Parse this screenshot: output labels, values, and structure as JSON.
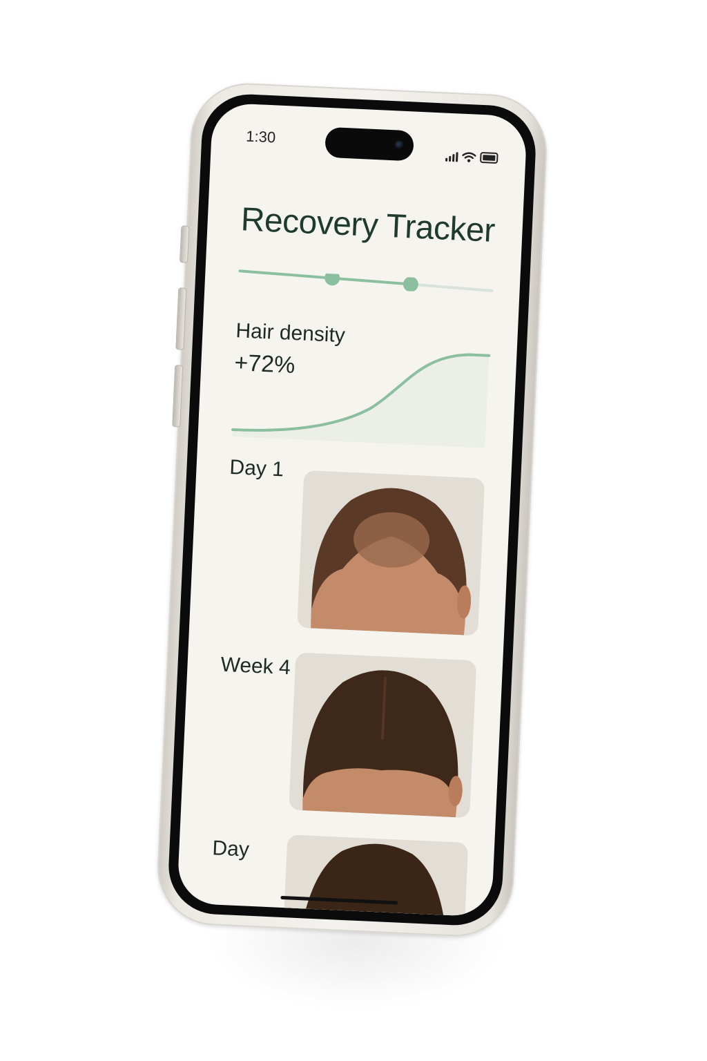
{
  "status_bar": {
    "time": "1:30"
  },
  "screen": {
    "title": "Recovery Tracker",
    "progress_stepper": {
      "steps_completed": 2,
      "accent_color": "#8cbf9f",
      "track_color": "#d9e2dc"
    },
    "metric": {
      "label": "Hair density",
      "value": "+72%"
    },
    "entries": [
      {
        "label": "Day 1",
        "image": "scalp-photo-day-1"
      },
      {
        "label": "Week 4",
        "image": "scalp-photo-week-4"
      },
      {
        "label": "Day",
        "image": "scalp-photo-day"
      }
    ]
  },
  "colors": {
    "screen_background": "#f6f4ef",
    "title_text": "#1f3a2e",
    "accent_green": "#8cbf9f",
    "phone_frame": "#eceae5"
  }
}
